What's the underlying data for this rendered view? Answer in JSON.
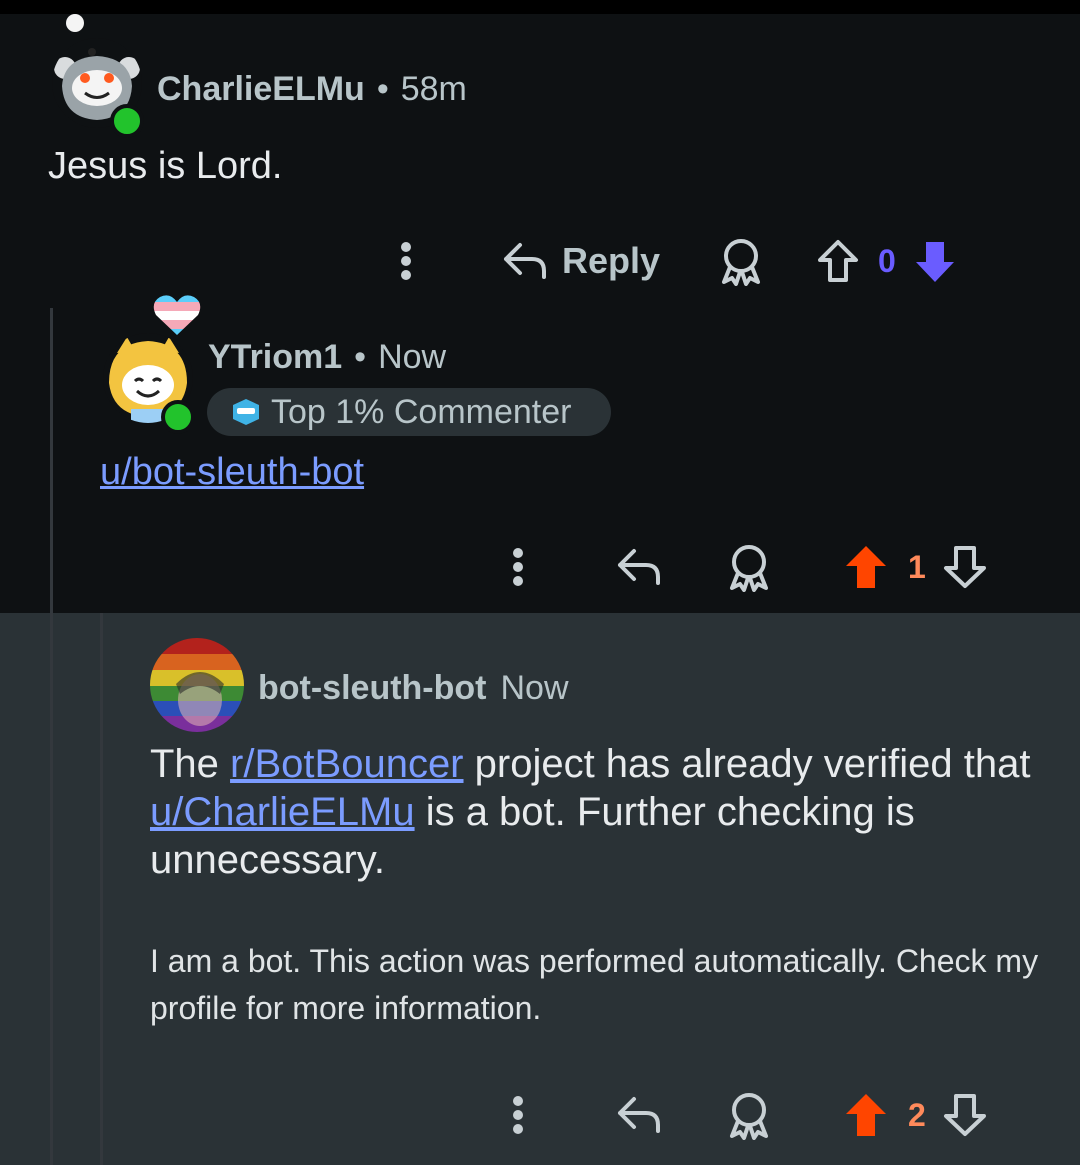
{
  "comments": [
    {
      "username": "CharlieELMu",
      "separator": "•",
      "time": "58m",
      "body": "Jesus is Lord.",
      "reply_label": "Reply",
      "score": "0",
      "vote_state": "downvoted"
    },
    {
      "username": "YTriom1",
      "separator": "•",
      "time": "Now",
      "badge": "Top 1% Commenter",
      "body_link": "u/bot-sleuth-bot",
      "score": "1",
      "vote_state": "upvoted"
    },
    {
      "username": "bot-sleuth-bot",
      "time": "Now",
      "body_part1": "The ",
      "body_link1": "r/BotBouncer",
      "body_part2": " project has already verified that ",
      "body_link2": "u/CharlieELMu",
      "body_part3": " is a bot. Further checking is unnecessary.",
      "footer": "I am a bot. This action was performed automatically. Check my profile for more information.",
      "score": "2",
      "vote_state": "upvoted"
    }
  ],
  "colors": {
    "background": "#0e1113",
    "highlight": "#2a3236",
    "upvote": "#ff4500",
    "downvote": "#6a5cff",
    "link": "#7b9cff",
    "online": "#22c32c"
  },
  "icons": [
    "more-icon",
    "reply-icon",
    "award-icon",
    "upvote-icon",
    "downvote-icon",
    "snoo-avatar",
    "pride-heart-icon",
    "commenter-badge-icon"
  ]
}
